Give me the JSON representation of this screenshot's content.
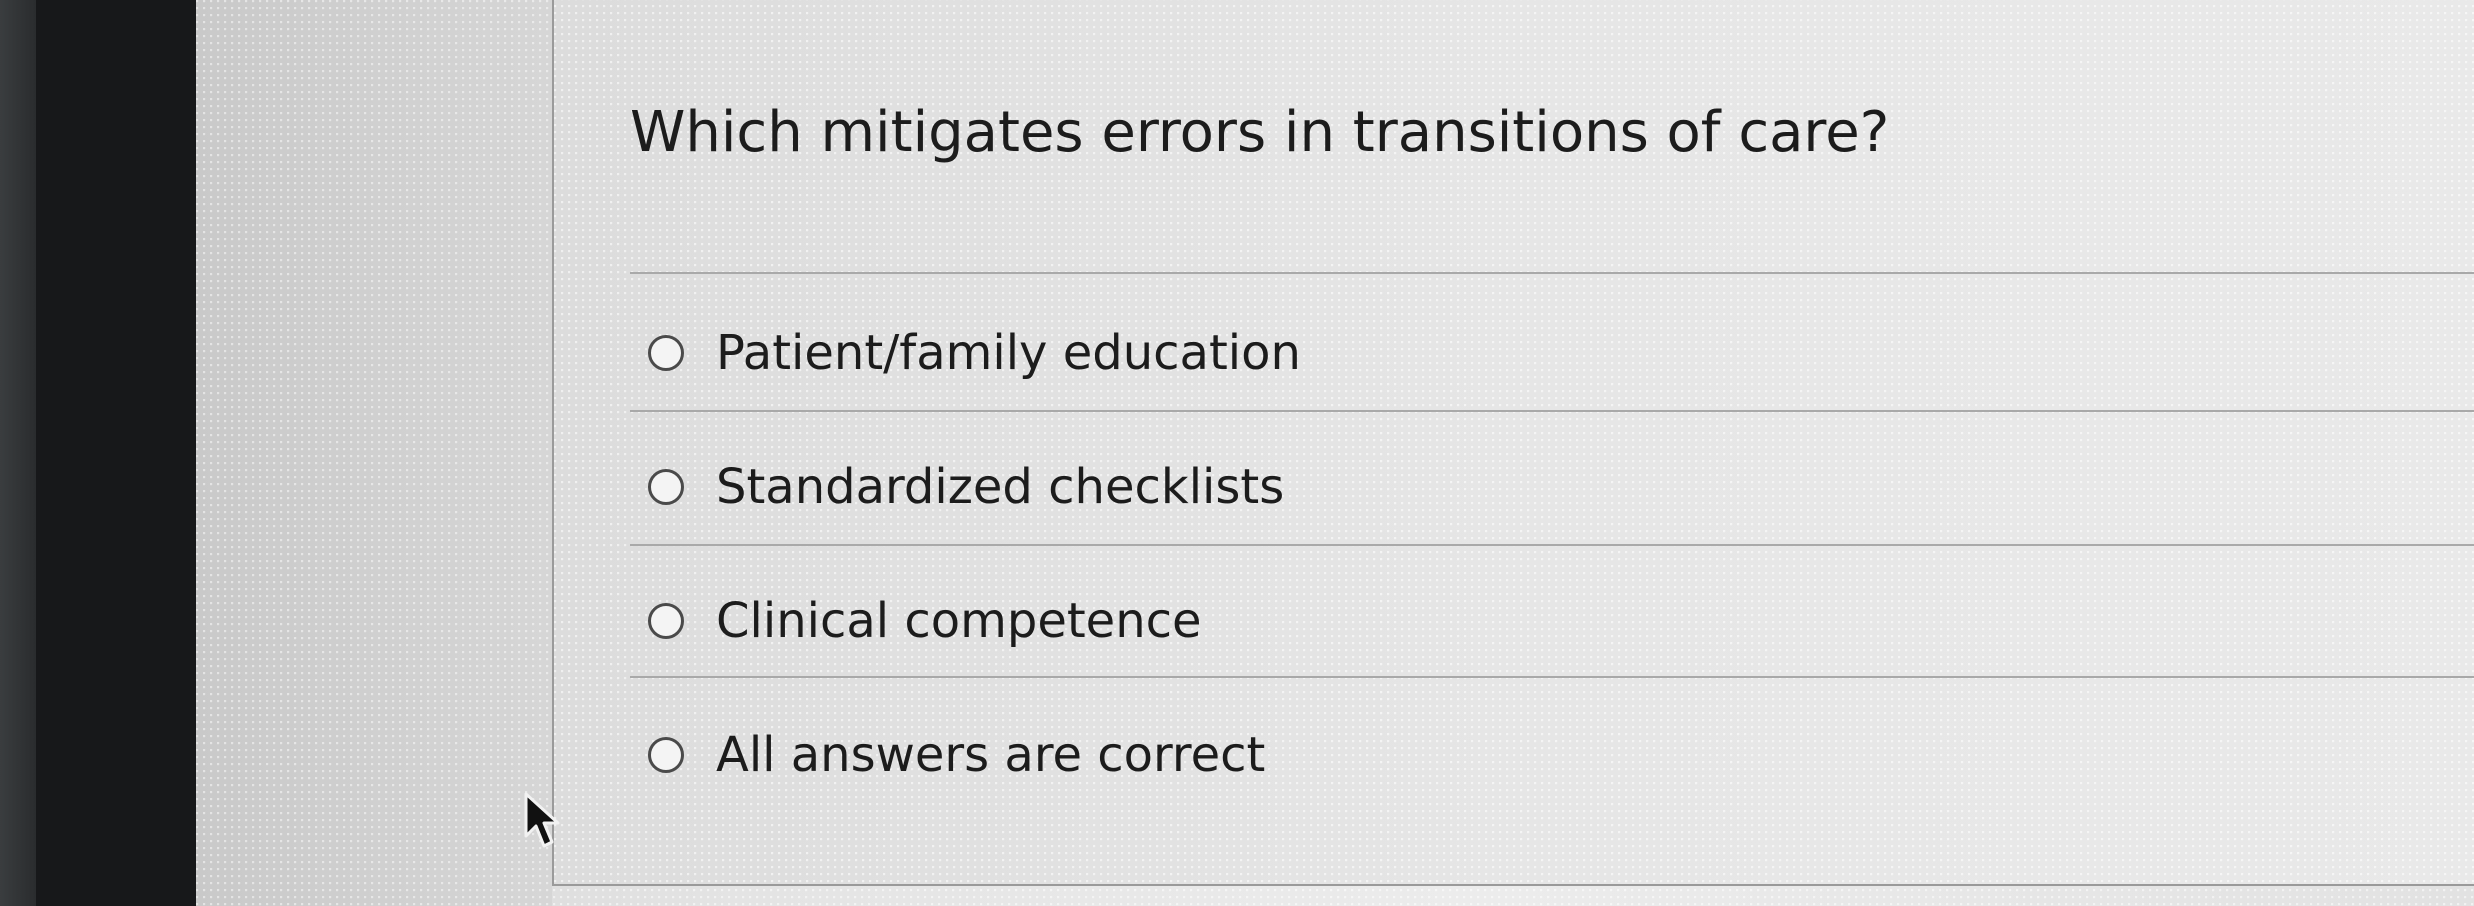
{
  "question": {
    "text": "Which mitigates errors in transitions of care?"
  },
  "options": [
    {
      "label": "Patient/family education",
      "selected": false
    },
    {
      "label": "Standardized checklists",
      "selected": false
    },
    {
      "label": "Clinical competence",
      "selected": false
    },
    {
      "label": "All answers are correct",
      "selected": false
    }
  ],
  "icons": {
    "radio": "radio-button-icon",
    "cursor": "mouse-pointer-icon"
  },
  "colors": {
    "text": "#1c1c1c",
    "divider": "#a9a9a9",
    "bezel": "#17181a"
  }
}
